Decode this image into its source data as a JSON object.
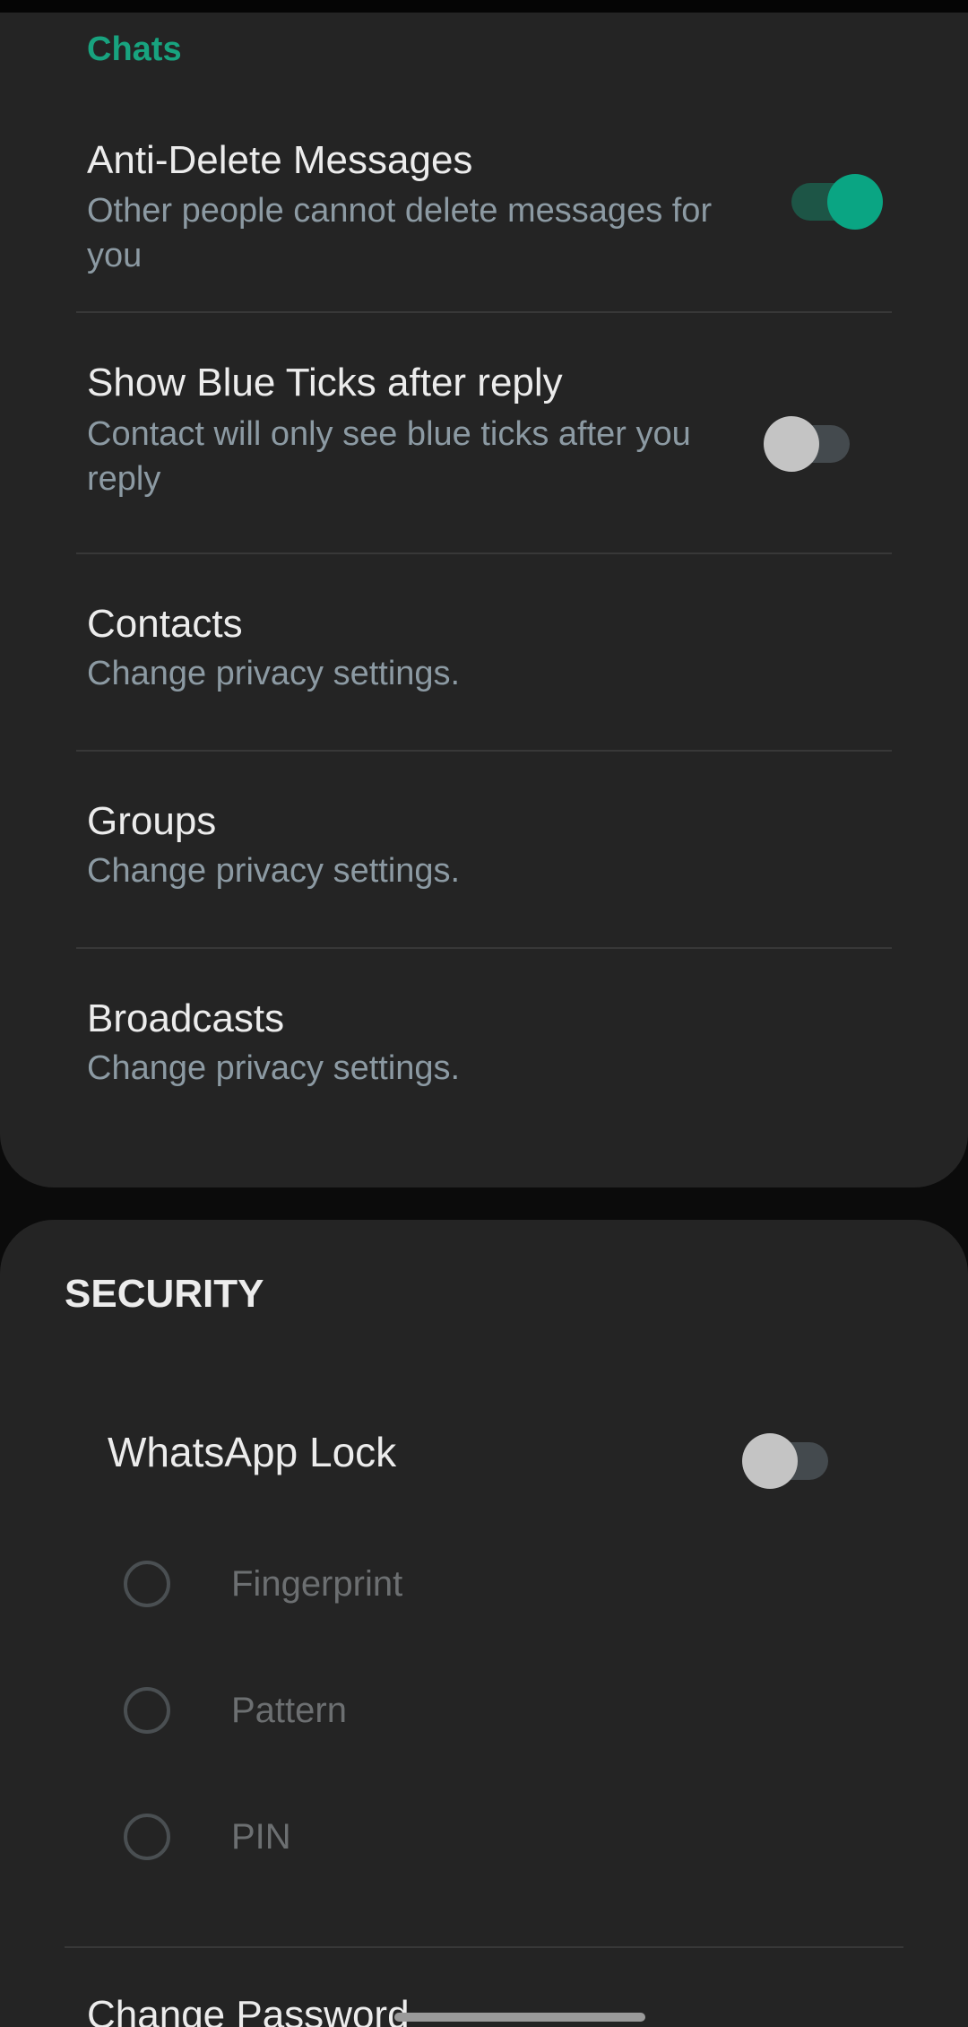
{
  "chats_section": {
    "label": "Chats",
    "items": [
      {
        "title": "Anti-Delete Messages",
        "summary": "Other people cannot delete messages for you",
        "toggle": "on"
      },
      {
        "title": "Show Blue Ticks after reply",
        "summary": "Contact will only see blue ticks after you reply",
        "toggle": "off"
      },
      {
        "title": "Contacts",
        "summary": "Change privacy settings."
      },
      {
        "title": "Groups",
        "summary": "Change privacy settings."
      },
      {
        "title": "Broadcasts",
        "summary": "Change privacy settings."
      }
    ]
  },
  "security_section": {
    "header": "SECURITY",
    "lock": {
      "title": "WhatsApp Lock",
      "toggle": "off"
    },
    "lock_options": [
      {
        "label": "Fingerprint"
      },
      {
        "label": "Pattern"
      },
      {
        "label": "PIN"
      }
    ],
    "change_password": "Change Password"
  },
  "colors": {
    "accent": "#18a37f",
    "toggle_on_thumb": "#0aa583",
    "card_background": "#242424",
    "page_background": "#0b0b0b",
    "summary_text": "#8c9aa3"
  }
}
